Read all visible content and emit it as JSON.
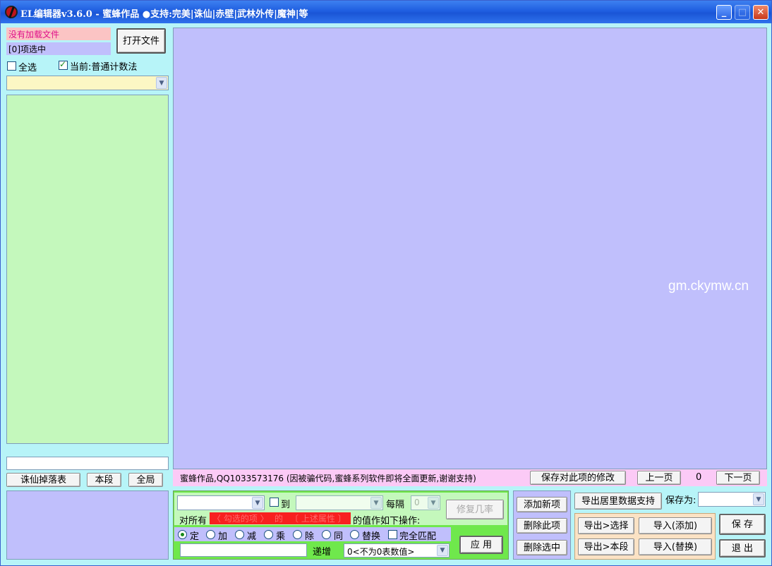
{
  "title": "EL编辑器v3.6.0   -   蜜蜂作品     ●支持:完美|诛仙|赤壁|武林外传|魔神|等",
  "window_buttons": {
    "min": "_",
    "max": "□",
    "close": "✕"
  },
  "left": {
    "file_status": "没有加载文件",
    "selection_count": "[0]项选中",
    "open_button": "打开文件",
    "select_all_label": "全选",
    "current_label": "当前:普通计数法",
    "buttons": {
      "zhuxian": "诛仙掉落表",
      "this_section": "本段",
      "global": "全局"
    }
  },
  "status_bar": {
    "info": "蜜蜂作品,QQ1033573176 (因被骗代码,蜜蜂系列软件即将全面更新,谢谢支持)",
    "save_changes": "保存对此项的修改",
    "prev_page": "上一页",
    "page_number": "0",
    "next_page": "下一页"
  },
  "ops": {
    "to_label": "到",
    "every_label": "每隔",
    "every_value": "0",
    "fix_rate": "修复几率",
    "line_prefix": "对所有",
    "checked_items": "〈 勾选的项 〉",
    "of": "的",
    "attributes": "〔 上述属性 〕",
    "line_suffix": "的值作如下操作:",
    "radios": [
      "定",
      "加",
      "减",
      "乘",
      "除",
      "同",
      "替换"
    ],
    "exact_match": "完全匹配",
    "increment_label": "递增",
    "increment_option": "0<不为0表数值>",
    "apply": "应 用"
  },
  "item_buttons": {
    "add": "添加新项",
    "delete_this": "删除此项",
    "delete_selected": "删除选中"
  },
  "export": {
    "export_support": "导出居里数据支持",
    "save_as_label": "保存为:",
    "export_select": "导出>选择",
    "import_add": "导入(添加)",
    "export_section": "导出>本段",
    "import_replace": "导入(替换)",
    "save": "保 存",
    "exit": "退 出"
  },
  "watermark": "gm.ckymw.cn",
  "colors": {
    "window_bg": "#b7f4f8",
    "list_green": "#c4f8bc",
    "main_lavender": "#c0bffc",
    "status_pink": "#fbcaf6"
  }
}
